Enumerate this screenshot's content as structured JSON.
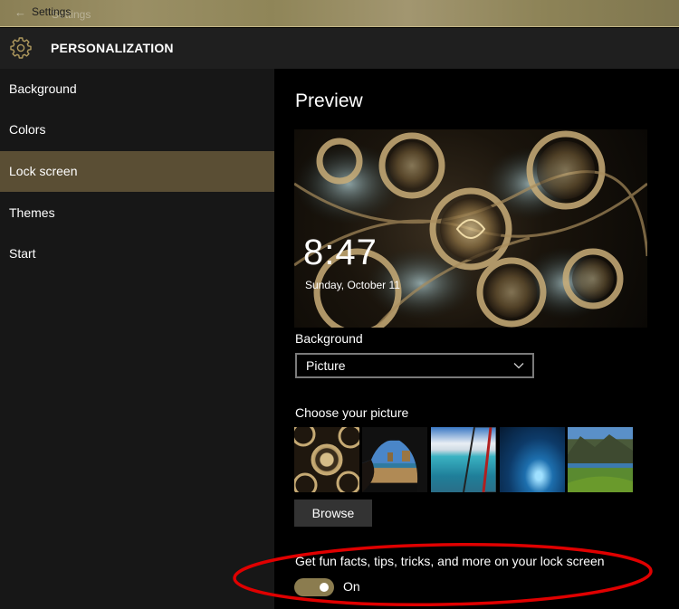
{
  "titlebar": {
    "back_icon": "back-arrow-icon",
    "title": "Settings",
    "ghost_title": "Settings"
  },
  "header": {
    "icon": "gear-icon",
    "title": "PERSONALIZATION",
    "accent_color": "#b09a5e"
  },
  "sidebar": {
    "items": [
      {
        "label": "Background",
        "active": false
      },
      {
        "label": "Colors",
        "active": false
      },
      {
        "label": "Lock screen",
        "active": true
      },
      {
        "label": "Themes",
        "active": false
      },
      {
        "label": "Start",
        "active": false
      }
    ],
    "active_color": "#5a4e34"
  },
  "main": {
    "preview_title": "Preview",
    "preview": {
      "time": "8:47",
      "date": "Sunday, October 11"
    },
    "background_label": "Background",
    "background_dropdown": {
      "selected": "Picture",
      "icon": "chevron-down-icon"
    },
    "choose_picture_label": "Choose your picture",
    "thumbnails": [
      {
        "name": "fractal-gold"
      },
      {
        "name": "beach-cave"
      },
      {
        "name": "aerial-ocean"
      },
      {
        "name": "ice-cave"
      },
      {
        "name": "mountain-lake"
      }
    ],
    "browse_label": "Browse",
    "fun_facts": {
      "label": "Get fun facts, tips, tricks, and more on your lock screen",
      "state": "On",
      "enabled": true,
      "toggle_color": "#8b7c4f"
    }
  },
  "annotation": {
    "shape": "ellipse",
    "color": "#e00000"
  }
}
